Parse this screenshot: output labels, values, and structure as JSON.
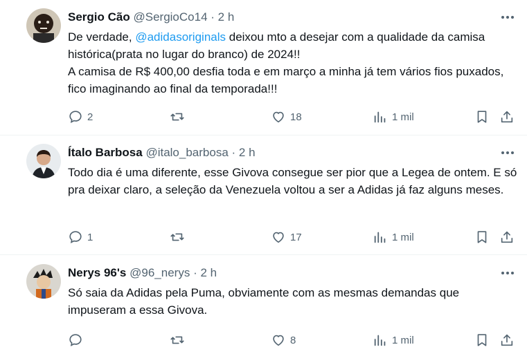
{
  "tweets": [
    {
      "name": "Sergio Cão",
      "handle": "@SergioCo14",
      "dot": "·",
      "time": "2 h",
      "text_before_mention": "De verdade, ",
      "mention": "@adidasoriginals",
      "text_after_mention": "  deixou mto a desejar com a qualidade da camisa histórica(prata no lugar do branco) de 2024!!",
      "text_line2": "A camisa de R$ 400,00 desfia toda e em março a minha já tem vários fios puxados, fico imaginando ao final da temporada!!!",
      "replies": "2",
      "reposts": "",
      "likes": "18",
      "views": "1 mil"
    },
    {
      "name": "Ítalo Barbosa",
      "handle": "@italo_barbosa",
      "dot": "·",
      "time": "2 h",
      "text": "Todo dia é uma diferente, esse Givova consegue ser pior que a Legea de ontem. E só pra deixar claro, a seleção da Venezuela voltou a ser a Adidas já faz alguns meses.",
      "replies": "1",
      "reposts": "",
      "likes": "17",
      "views": "1 mil"
    },
    {
      "name": "Nerys 96's",
      "handle": "@96_nerys",
      "dot": "·",
      "time": "2 h",
      "text": "Só saia da Adidas pela Puma, obviamente com as mesmas demandas que impuseram a essa Givova.",
      "replies": "",
      "reposts": "",
      "likes": "8",
      "views": "1 mil"
    }
  ],
  "icons": {
    "more": "more-horizontal-icon",
    "reply": "reply-bubble-icon",
    "repost": "repost-arrows-icon",
    "like": "heart-icon",
    "views": "views-bar-chart-icon",
    "bookmark": "bookmark-icon",
    "share": "share-upload-icon"
  },
  "colors": {
    "text": "#0f1419",
    "secondary": "#536471",
    "mention": "#1d9bf0",
    "divider": "#eff3f4"
  }
}
